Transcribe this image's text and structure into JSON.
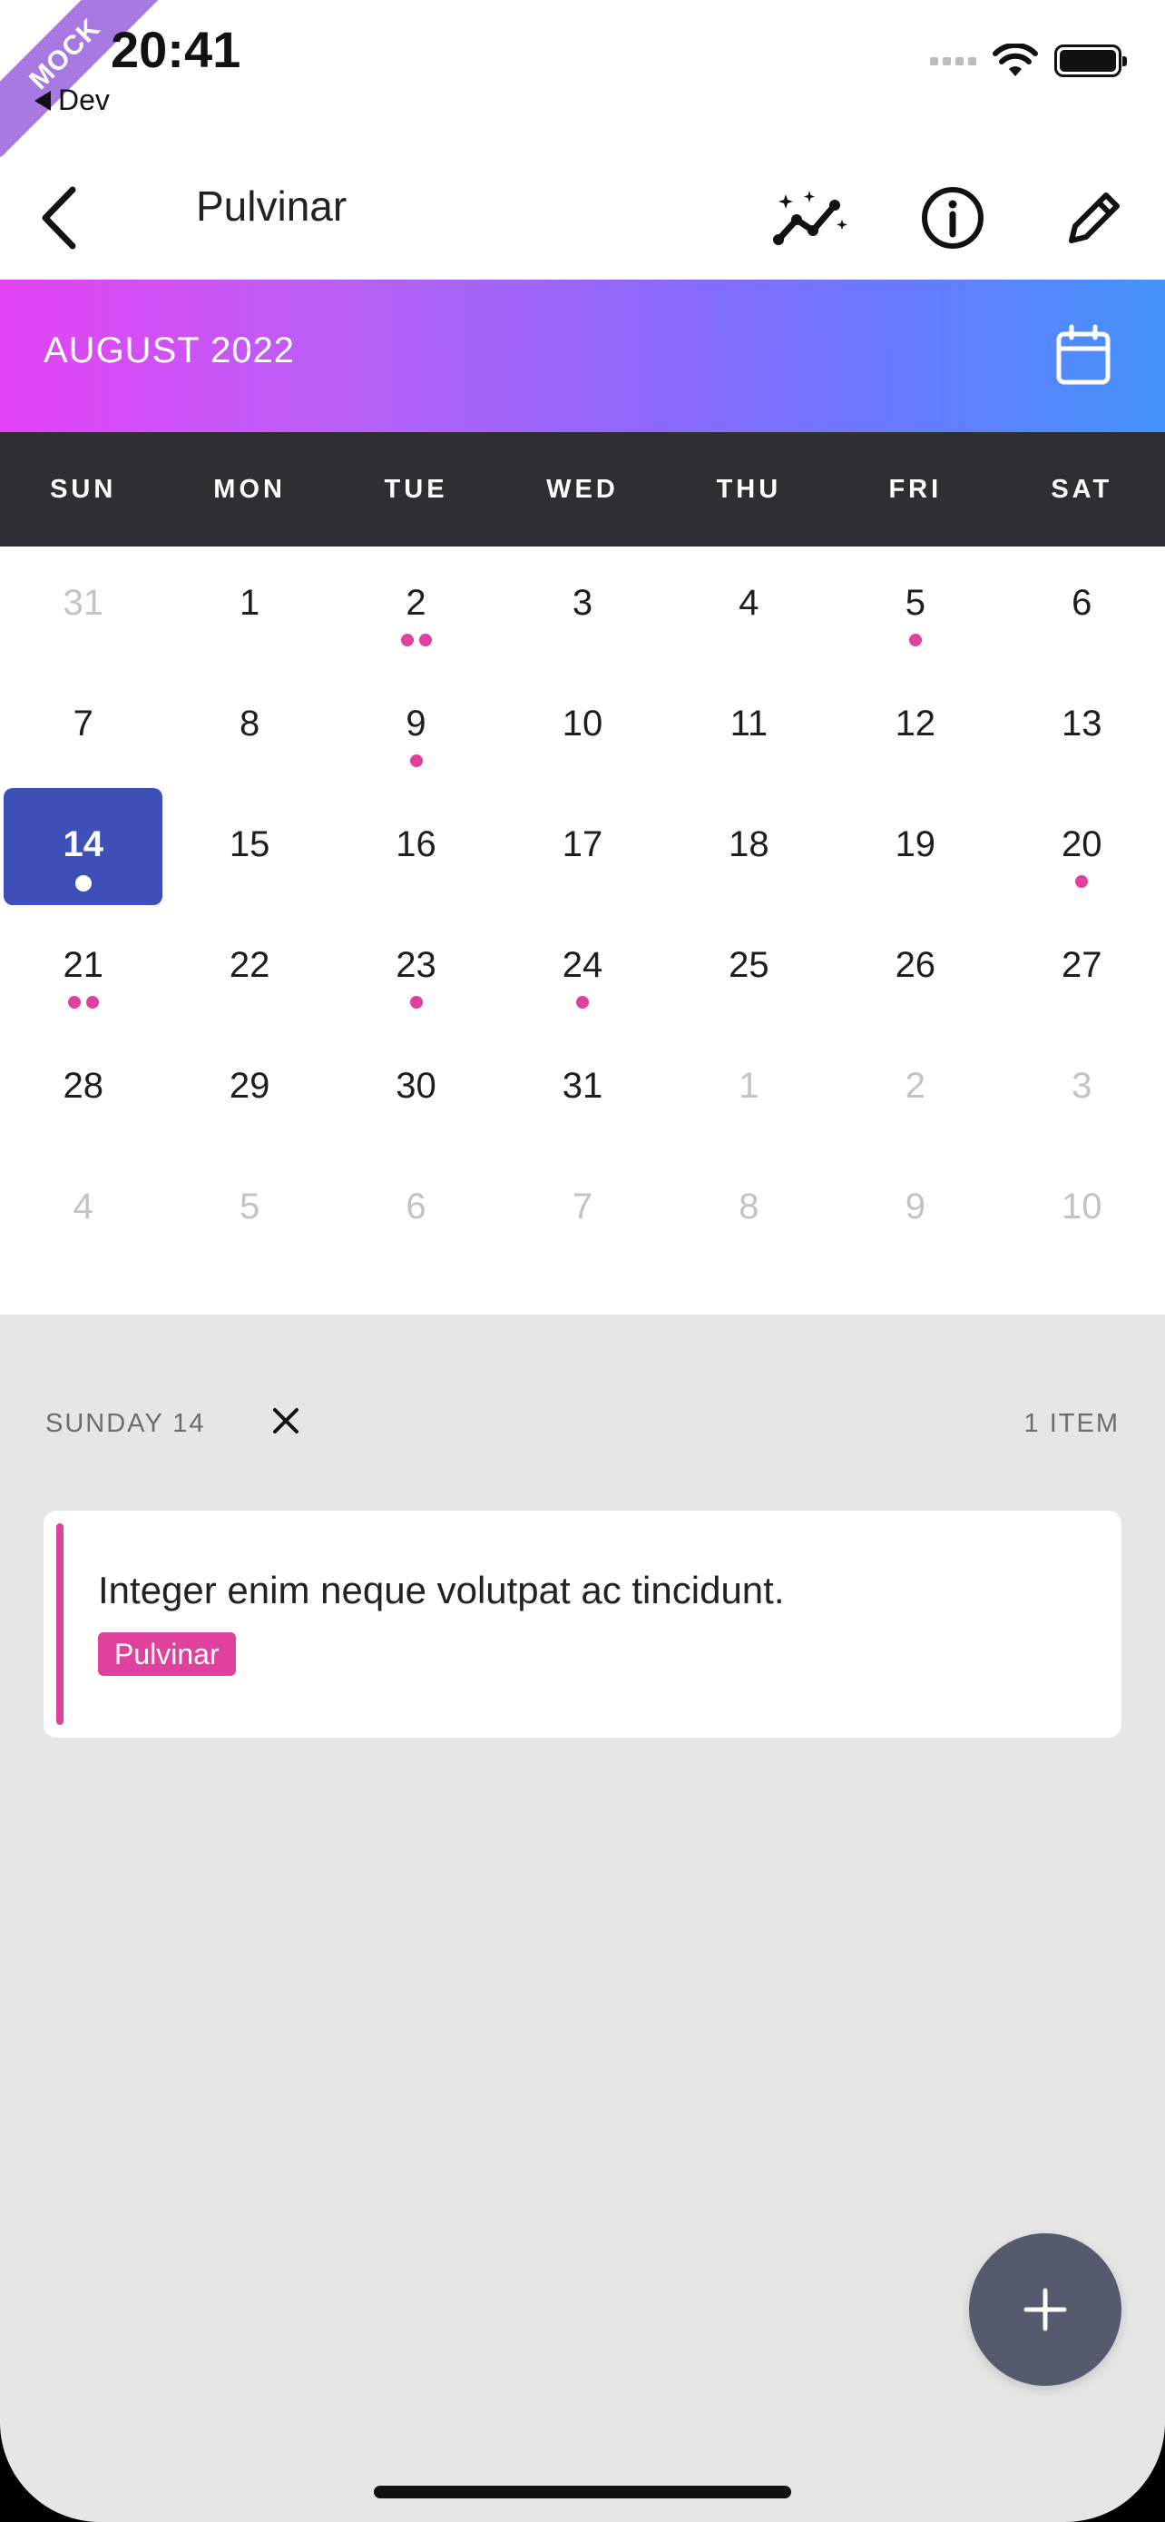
{
  "status_bar": {
    "badge": "MOCK",
    "time": "20:41",
    "back_app": "Dev"
  },
  "header": {
    "title": "Pulvinar",
    "icons": [
      "back-chevron-icon",
      "sparkle-chart-icon",
      "info-icon",
      "pencil-icon"
    ]
  },
  "calendar": {
    "month_label": "AUGUST 2022",
    "weekdays": [
      "SUN",
      "MON",
      "TUE",
      "WED",
      "THU",
      "FRI",
      "SAT"
    ],
    "weeks": [
      [
        {
          "d": "31",
          "faded": true,
          "dots": 0
        },
        {
          "d": "1",
          "dots": 0
        },
        {
          "d": "2",
          "dots": 2
        },
        {
          "d": "3",
          "dots": 0
        },
        {
          "d": "4",
          "dots": 0
        },
        {
          "d": "5",
          "dots": 1
        },
        {
          "d": "6",
          "dots": 0
        }
      ],
      [
        {
          "d": "7",
          "dots": 0
        },
        {
          "d": "8",
          "dots": 0
        },
        {
          "d": "9",
          "dots": 1
        },
        {
          "d": "10",
          "dots": 0
        },
        {
          "d": "11",
          "dots": 0
        },
        {
          "d": "12",
          "dots": 0
        },
        {
          "d": "13",
          "dots": 0
        }
      ],
      [
        {
          "d": "14",
          "dots": 1,
          "selected": true
        },
        {
          "d": "15",
          "dots": 0
        },
        {
          "d": "16",
          "dots": 0
        },
        {
          "d": "17",
          "dots": 0
        },
        {
          "d": "18",
          "dots": 0
        },
        {
          "d": "19",
          "dots": 0
        },
        {
          "d": "20",
          "dots": 1
        }
      ],
      [
        {
          "d": "21",
          "dots": 2
        },
        {
          "d": "22",
          "dots": 0
        },
        {
          "d": "23",
          "dots": 1
        },
        {
          "d": "24",
          "dots": 1
        },
        {
          "d": "25",
          "dots": 0
        },
        {
          "d": "26",
          "dots": 0
        },
        {
          "d": "27",
          "dots": 0
        }
      ],
      [
        {
          "d": "28",
          "dots": 0
        },
        {
          "d": "29",
          "dots": 0
        },
        {
          "d": "30",
          "dots": 0
        },
        {
          "d": "31",
          "dots": 0
        },
        {
          "d": "1",
          "faded": true,
          "dots": 0
        },
        {
          "d": "2",
          "faded": true,
          "dots": 0
        },
        {
          "d": "3",
          "faded": true,
          "dots": 0
        }
      ],
      [
        {
          "d": "4",
          "faded": true,
          "dots": 0
        },
        {
          "d": "5",
          "faded": true,
          "dots": 0
        },
        {
          "d": "6",
          "faded": true,
          "dots": 0
        },
        {
          "d": "7",
          "faded": true,
          "dots": 0
        },
        {
          "d": "8",
          "faded": true,
          "dots": 0
        },
        {
          "d": "9",
          "faded": true,
          "dots": 0
        },
        {
          "d": "10",
          "faded": true,
          "dots": 0
        }
      ]
    ]
  },
  "agenda": {
    "selected_date": "SUNDAY 14",
    "item_count": "1 ITEM",
    "items": [
      {
        "text": "Integer enim neque volutpat ac tincidunt.",
        "tag": "Pulvinar"
      }
    ]
  },
  "colors": {
    "accent_pink": "#e0409e",
    "selected_day": "#3e4fb8",
    "weekday_bar": "#2e2e33",
    "fab": "#565a6e"
  }
}
